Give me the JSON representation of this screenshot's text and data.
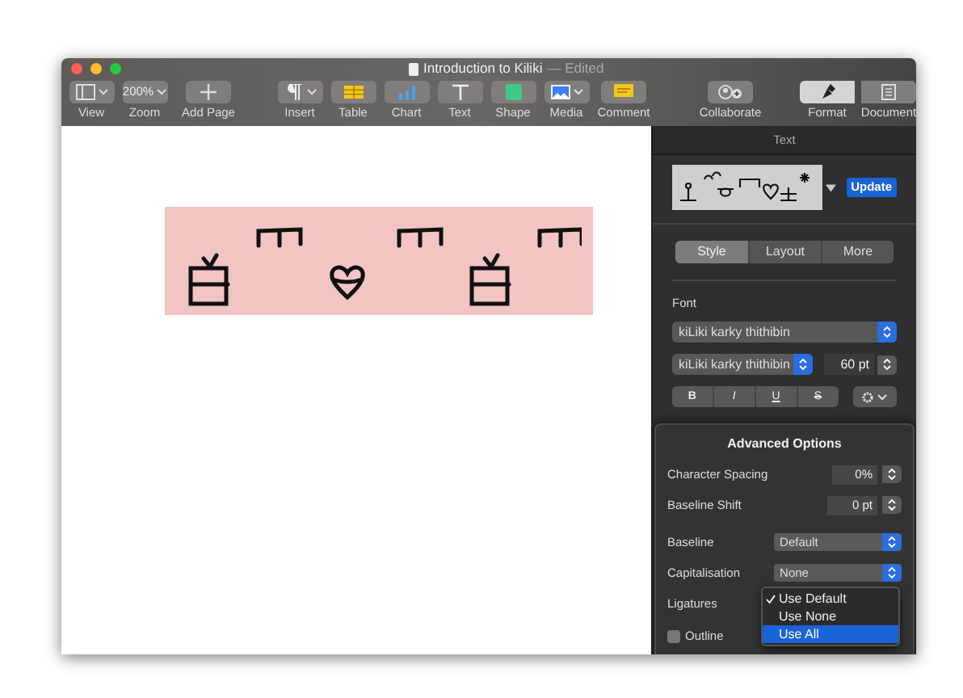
{
  "window": {
    "title": "Introduction to Kiliki",
    "status": "— Edited"
  },
  "toolbar_groups": [
    {
      "items": [
        {
          "label": "View",
          "kind": "view"
        },
        {
          "label": "200%",
          "caption": "Zoom",
          "kind": "zoom"
        },
        {
          "label": "Add Page",
          "kind": "plus"
        }
      ]
    },
    {
      "items": [
        {
          "label": "Insert",
          "kind": "paragraph"
        },
        {
          "label": "Table",
          "kind": "table"
        },
        {
          "label": "Chart",
          "kind": "chart"
        },
        {
          "label": "Text",
          "kind": "text"
        },
        {
          "label": "Shape",
          "kind": "shape"
        },
        {
          "label": "Media",
          "kind": "media"
        },
        {
          "label": "Comment",
          "kind": "comment"
        }
      ]
    },
    {
      "items": [
        {
          "label": "Collaborate",
          "kind": "collaborate"
        }
      ]
    }
  ],
  "inspector_tabs": [
    {
      "label": "Format",
      "kind": "brush",
      "selected": true
    },
    {
      "label": "Document",
      "kind": "document",
      "selected": false
    }
  ],
  "sidebar": {
    "header": "Text",
    "update_button": "Update",
    "tabs": [
      {
        "label": "Style",
        "selected": true
      },
      {
        "label": "Layout",
        "selected": false
      },
      {
        "label": "More",
        "selected": false
      }
    ],
    "font_label": "Font",
    "font_family": "kiLiki karky thithibin",
    "typeface": "kiLiki karky thithibin",
    "size": "60 pt",
    "style_buttons": [
      {
        "label": "B",
        "kind": "bold"
      },
      {
        "label": "I",
        "kind": "italic"
      },
      {
        "label": "U",
        "kind": "underline"
      },
      {
        "label": "S",
        "kind": "strike"
      }
    ]
  },
  "advanced": {
    "title": "Advanced Options",
    "rows": [
      {
        "label": "Character Spacing",
        "kind": "stepper",
        "value": "0%"
      },
      {
        "label": "Baseline Shift",
        "kind": "stepper",
        "value": "0 pt"
      },
      {
        "label": "Baseline",
        "kind": "select",
        "value": "Default"
      },
      {
        "label": "Capitalisation",
        "kind": "select",
        "value": "None"
      },
      {
        "label": "Ligatures",
        "kind": "menu"
      }
    ],
    "menu": [
      {
        "label": "Use Default",
        "checked": true,
        "selected": false
      },
      {
        "label": "Use None",
        "checked": false,
        "selected": false
      },
      {
        "label": "Use All",
        "checked": false,
        "selected": true
      }
    ],
    "outline": {
      "label": "Outline",
      "checked": false
    }
  }
}
